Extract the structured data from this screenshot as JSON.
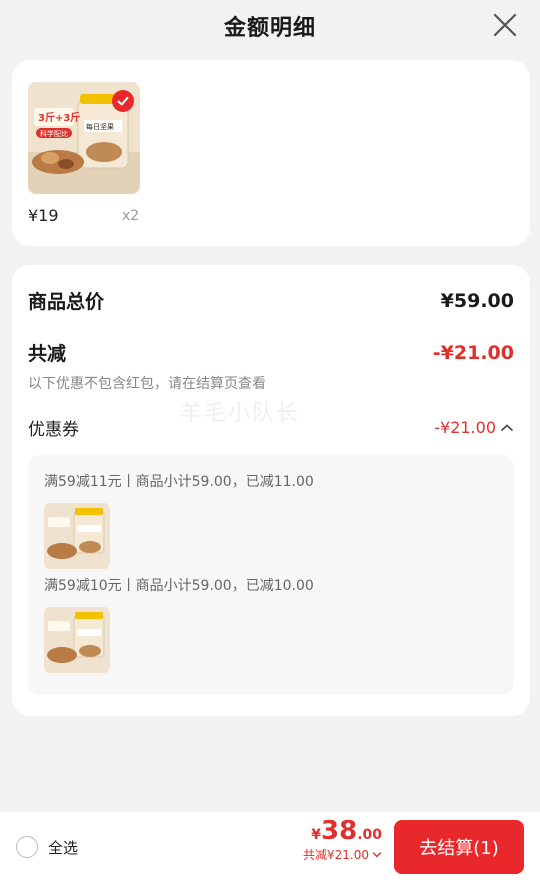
{
  "header": {
    "title": "金额明细"
  },
  "products": [
    {
      "price": "¥19",
      "qty": "x2",
      "label_top": "3斤+3斤",
      "label_sub": "科学配比",
      "jar_label": "每日坚果"
    }
  ],
  "detail": {
    "total_label": "商品总价",
    "total_value": "¥59.00",
    "reduce_label": "共减",
    "reduce_value": "-¥21.00",
    "note": "以下优惠不包含红包，请在结算页查看",
    "coupon_label": "优惠券",
    "coupon_value": "-¥21.00",
    "coupons": [
      {
        "text": "满59减11元丨商品小计59.00，已减11.00"
      },
      {
        "text": "满59减10元丨商品小计59.00，已减10.00"
      }
    ]
  },
  "watermark": "羊毛小队长",
  "footer": {
    "select_all": "全选",
    "price_currency": "¥",
    "price_int": "38",
    "price_dec": ".00",
    "reduce_text": "共减¥21.00",
    "checkout_label": "去结算(1)"
  },
  "colors": {
    "accent": "#e8282b",
    "reduce_text": "#e0302b",
    "page_bg": "#f2f2f2"
  }
}
